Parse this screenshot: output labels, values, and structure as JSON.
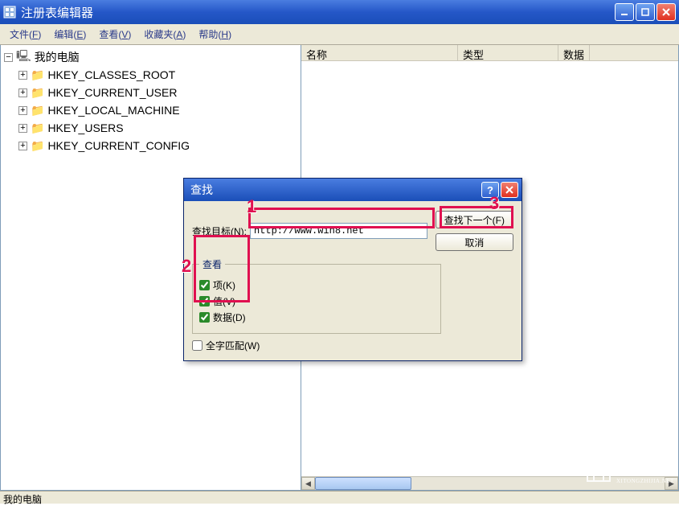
{
  "titlebar": {
    "title": "注册表编辑器"
  },
  "menubar": [
    {
      "label": "文件",
      "accel": "F"
    },
    {
      "label": "编辑",
      "accel": "E"
    },
    {
      "label": "查看",
      "accel": "V"
    },
    {
      "label": "收藏夹",
      "accel": "A"
    },
    {
      "label": "帮助",
      "accel": "H"
    }
  ],
  "tree": {
    "root": "我的电脑",
    "hives": [
      "HKEY_CLASSES_ROOT",
      "HKEY_CURRENT_USER",
      "HKEY_LOCAL_MACHINE",
      "HKEY_USERS",
      "HKEY_CURRENT_CONFIG"
    ]
  },
  "list": {
    "columns": [
      "名称",
      "类型",
      "数据"
    ]
  },
  "statusbar": {
    "text": "我的电脑"
  },
  "dialog": {
    "title": "查找",
    "find_label": "查找目标(N):",
    "find_value": "http://www.win8.net",
    "button_find_next": "查找下一个(F)",
    "button_cancel": "取消",
    "lookat_legend": "查看",
    "options": [
      {
        "label": "项(K)",
        "checked": true
      },
      {
        "label": "值(V)",
        "checked": true
      },
      {
        "label": "数据(D)",
        "checked": true
      }
    ],
    "match_whole": "全字匹配(W)"
  },
  "annotations": {
    "one": "1",
    "two": "2",
    "three": "3"
  },
  "watermark": {
    "text": "系统之家",
    "sub": "XITONGZHIJIA.NET"
  }
}
